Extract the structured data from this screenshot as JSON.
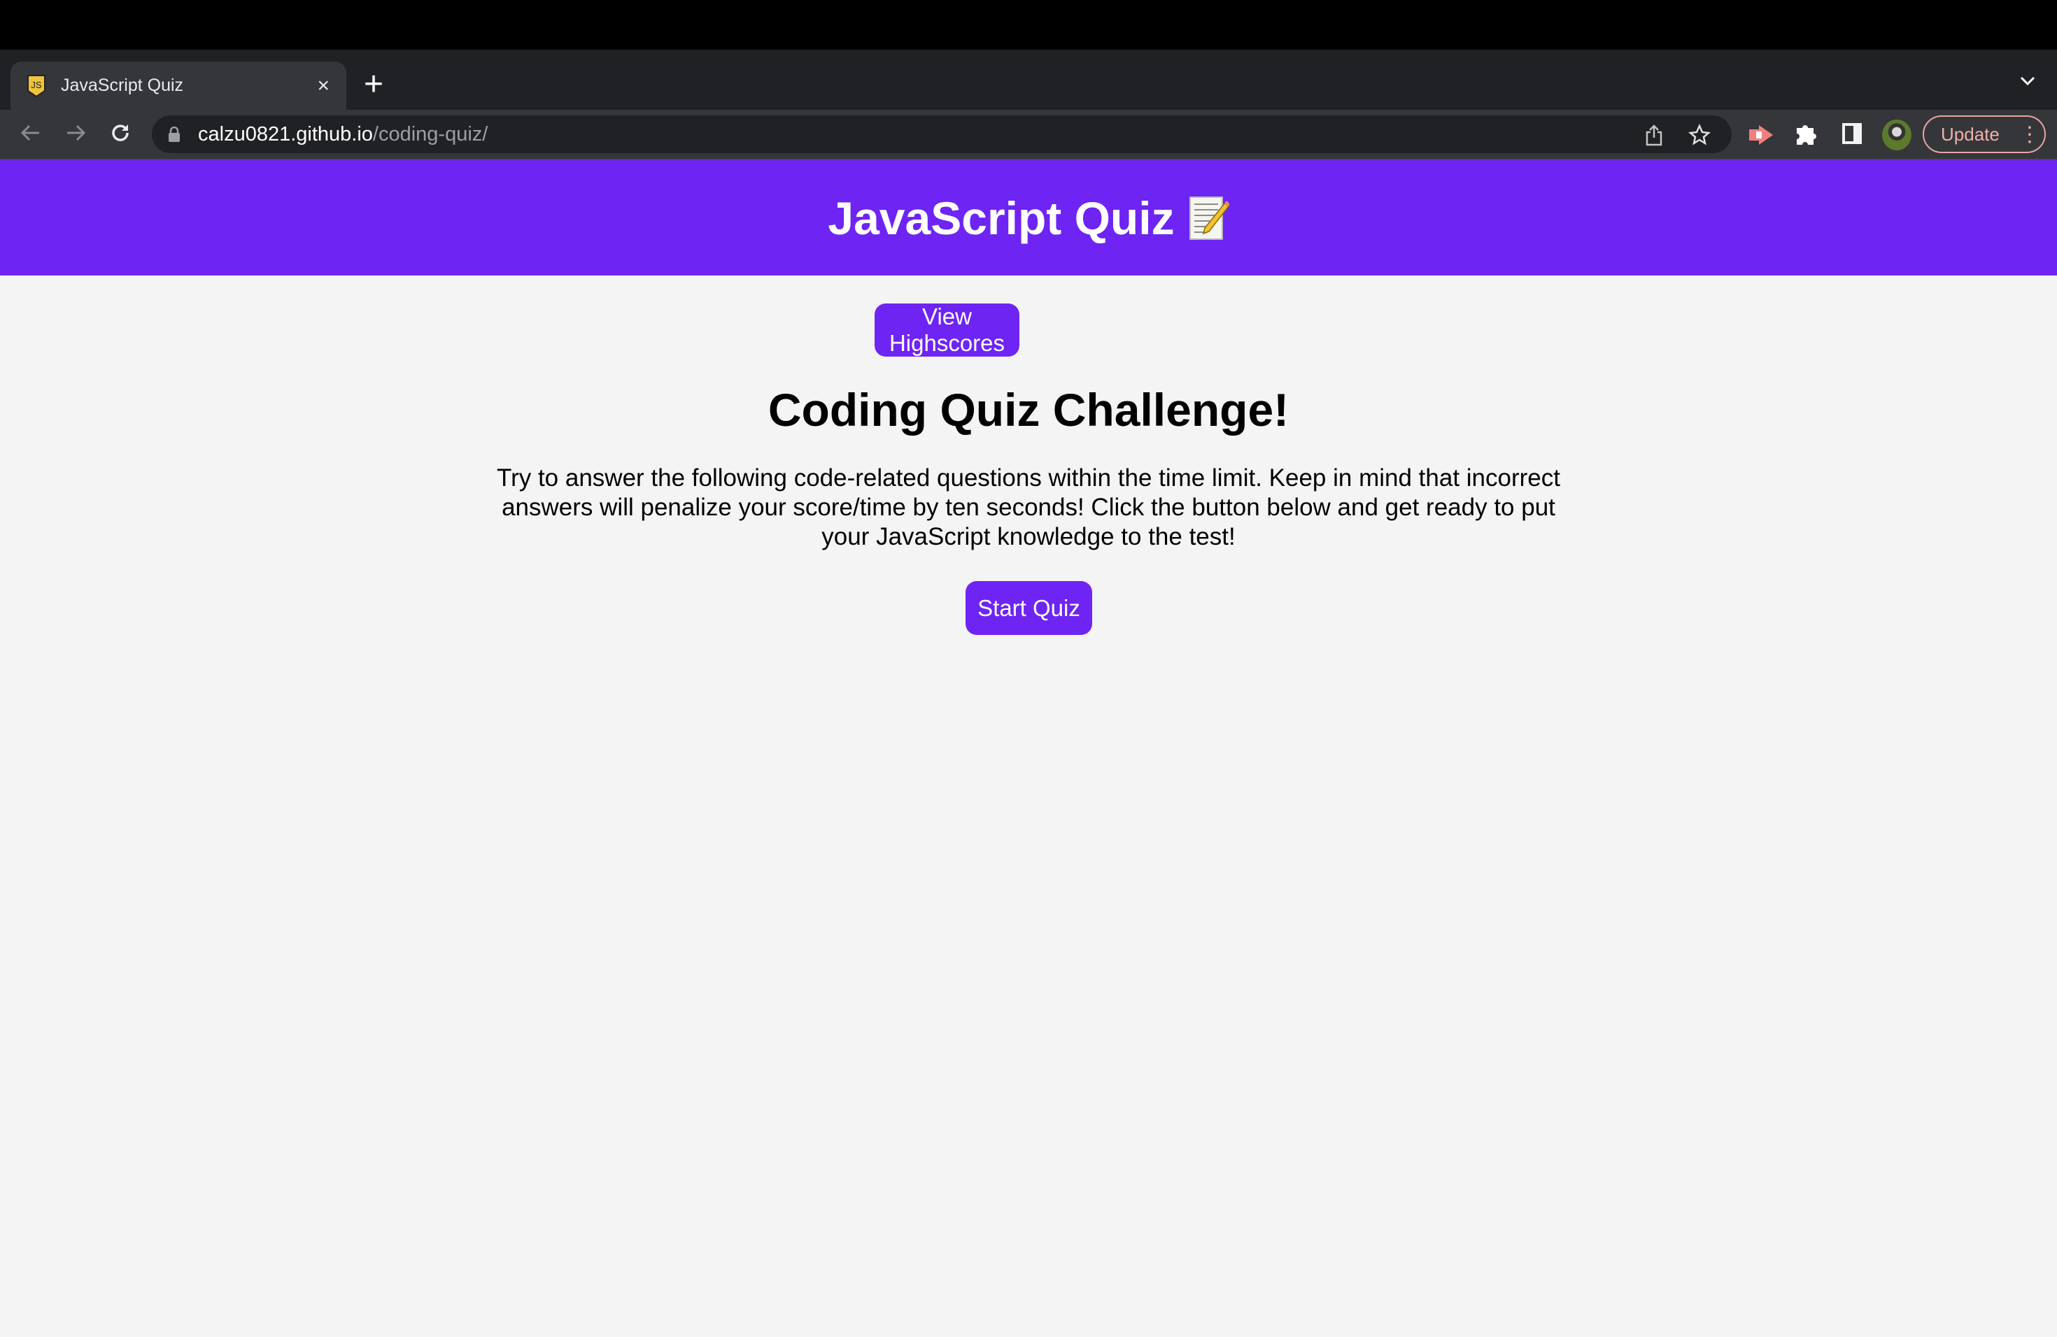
{
  "browser": {
    "tab_title": "JavaScript Quiz",
    "tab_close": "×",
    "new_tab": "+",
    "url_host": "calzu0821.github.io",
    "url_path": "/coding-quiz/",
    "update_label": "Update",
    "menu_dots": "⋮",
    "tab_menu": "⌄"
  },
  "header": {
    "title": "JavaScript Quiz",
    "icon": "memo-icon"
  },
  "main": {
    "highscores_label": "View Highscores",
    "heading": "Coding Quiz Challenge!",
    "intro": "Try to answer the following code-related questions within the time limit. Keep in mind that incorrect answers will penalize your score/time by ten seconds! Click the button below and get ready to put your JavaScript knowledge to the test!",
    "start_label": "Start Quiz"
  },
  "colors": {
    "accent": "#6e24f3",
    "background": "#f4f4f4"
  }
}
